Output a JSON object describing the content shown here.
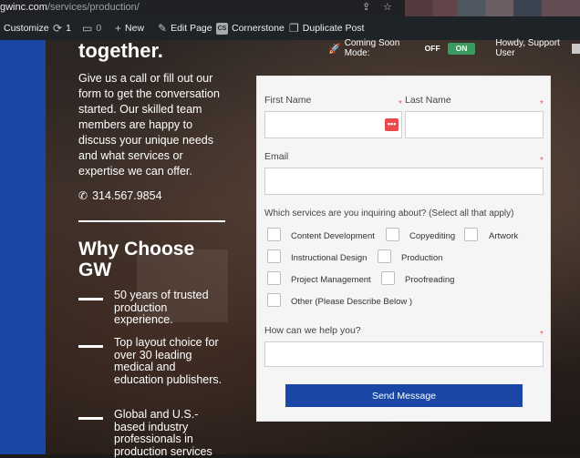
{
  "browser": {
    "url_host": "gwinc.com",
    "url_path": "/services/production/"
  },
  "adminbar": {
    "customize": "Customize",
    "updates_count": "1",
    "comments_count": "0",
    "new": "New",
    "edit_page": "Edit Page",
    "cornerstone": "Cornerstone",
    "duplicate_post": "Duplicate Post"
  },
  "coming_soon": {
    "label": "Coming Soon Mode:",
    "off": "OFF",
    "on": "ON",
    "howdy": "Howdy, Support User"
  },
  "left": {
    "heading_top": "together.",
    "intro": "Give us a call or fill out our form to get the conversation started. Our skilled team members are happy to discuss your unique needs and what services or expertise we can offer.",
    "phone": "314.567.9854",
    "why_heading_line1": "Why Choose",
    "why_heading_line2": "GW",
    "bullets": [
      "50 years of trusted production experience.",
      "Top layout choice for over 30 leading medical and education publishers.",
      "Global and U.S.-based industry professionals in production services"
    ]
  },
  "form": {
    "first_name_label": "First Name",
    "last_name_label": "Last Name",
    "email_label": "Email",
    "services_question": "Which services are you inquiring about? (Select all that apply)",
    "services": [
      "Content Development",
      "Copyediting",
      "Artwork",
      "Instructional Design",
      "Production",
      "Project Management",
      "Proofreading",
      "Other (Please Describe Below )"
    ],
    "help_label": "How can we help you?",
    "send_label": "Send Message",
    "required_mark": "*"
  },
  "colors": {
    "brand_blue": "#1a47a6",
    "admin_bar": "#1d2327",
    "toggle_on": "#3a9a5f",
    "required": "#e05a5a"
  }
}
